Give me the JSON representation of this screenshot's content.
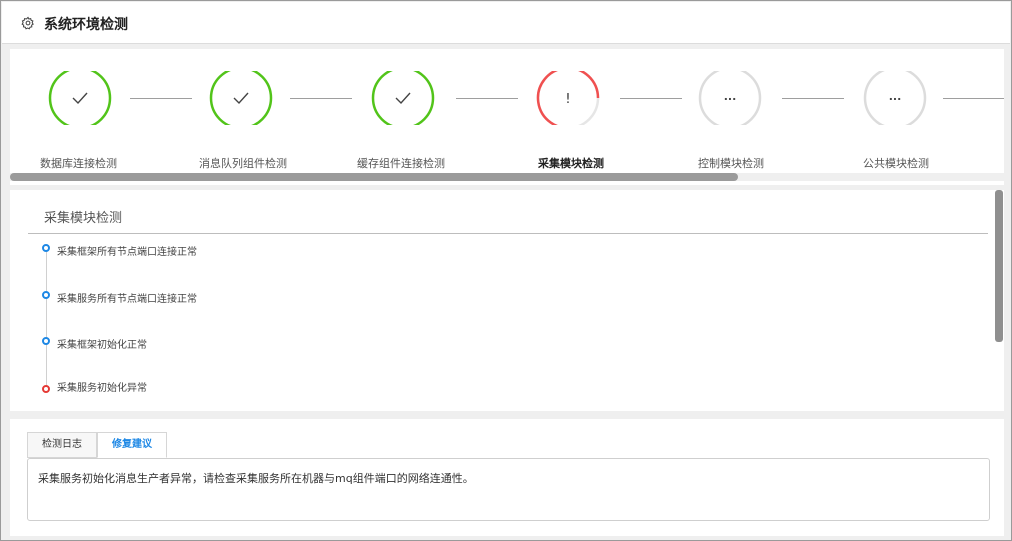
{
  "header": {
    "title": "系统环境检测",
    "icon": "gear-icon"
  },
  "steps": [
    {
      "label": "数据库连接检测",
      "status": "success",
      "symbol": "✓"
    },
    {
      "label": "消息队列组件检测",
      "status": "success",
      "symbol": "✓"
    },
    {
      "label": "缓存组件连接检测",
      "status": "success",
      "symbol": "✓"
    },
    {
      "label": "采集模块检测",
      "status": "error",
      "symbol": "!"
    },
    {
      "label": "控制模块检测",
      "status": "pending",
      "symbol": "..."
    },
    {
      "label": "公共模块检测",
      "status": "pending",
      "symbol": "..."
    }
  ],
  "colors": {
    "success": "#52c41a",
    "error": "#f05050",
    "pending": "#dcdcdc",
    "info": "#1e88e5"
  },
  "detail": {
    "title": "采集模块检测",
    "items": [
      {
        "text": "采集框架所有节点端口连接正常",
        "status": "ok"
      },
      {
        "text": "采集服务所有节点端口连接正常",
        "status": "ok"
      },
      {
        "text": "采集框架初始化正常",
        "status": "ok"
      },
      {
        "text": "采集服务初始化异常",
        "status": "error"
      }
    ]
  },
  "tabs": {
    "log_label": "检测日志",
    "fix_label": "修复建议",
    "active": "fix"
  },
  "fix_text": "采集服务初始化消息生产者异常，请检查采集服务所在机器与mq组件端口的网络连通性。"
}
